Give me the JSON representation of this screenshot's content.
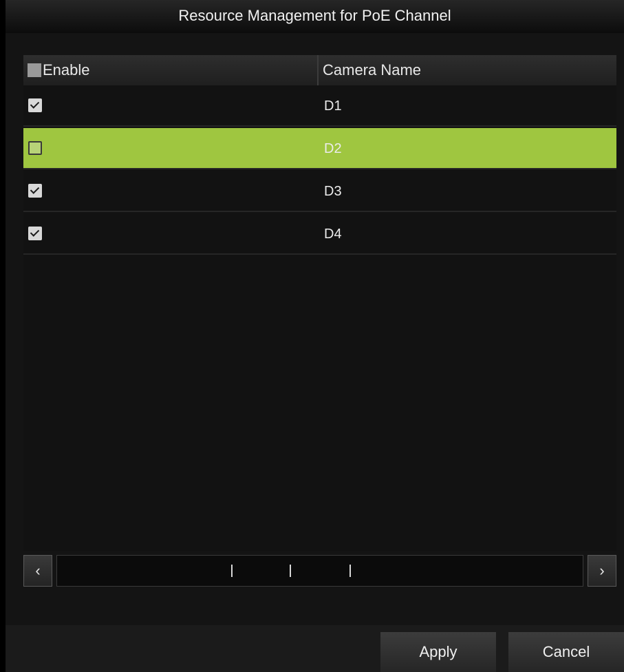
{
  "dialog": {
    "title": "Resource Management for PoE Channel"
  },
  "table": {
    "columns": {
      "enable": "Enable",
      "camera_name": "Camera Name"
    },
    "select_all_checked": false,
    "rows": [
      {
        "name": "D1",
        "enabled": true,
        "selected": false
      },
      {
        "name": "D2",
        "enabled": false,
        "selected": true
      },
      {
        "name": "D3",
        "enabled": true,
        "selected": false
      },
      {
        "name": "D4",
        "enabled": true,
        "selected": false
      }
    ]
  },
  "scrollbar": {
    "left_icon": "chevron-left-icon",
    "right_icon": "chevron-right-icon",
    "left_glyph": "‹",
    "right_glyph": "›"
  },
  "buttons": {
    "apply": "Apply",
    "cancel": "Cancel"
  },
  "colors": {
    "selected_row": "#9fc640",
    "background": "#141414"
  }
}
